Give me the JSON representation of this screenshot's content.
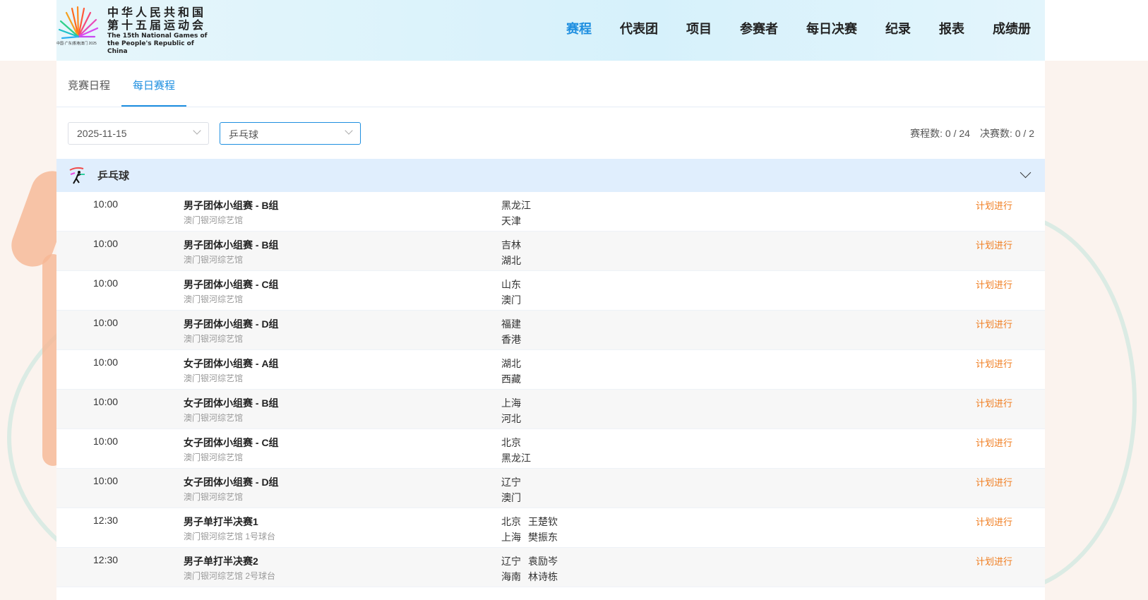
{
  "header": {
    "logo_cn_line1": "中华人民共和国",
    "logo_cn_line2": "第十五届运动会",
    "logo_en_line1": "The 15th National Games of",
    "logo_en_line2": "the People's Republic of China",
    "logo_small": "中国·广东|香港|澳门 2025",
    "nav": [
      "赛程",
      "代表团",
      "项目",
      "参赛者",
      "每日决赛",
      "纪录",
      "报表",
      "成绩册"
    ],
    "active_nav": "赛程"
  },
  "tabs": [
    "竞赛日程",
    "每日赛程"
  ],
  "filters": {
    "date": "2025-11-15",
    "sport": "乒乓球"
  },
  "counts": {
    "schedule": "赛程数: 0 / 24",
    "finals": "决赛数: 0 / 2"
  },
  "group": {
    "title": "乒乓球"
  },
  "rows": [
    {
      "time": "10:00",
      "event": "男子团体小组赛 - B组",
      "venue": "澳门银河综艺馆",
      "team1": "黑龙江",
      "team2": "天津",
      "status": "计划进行"
    },
    {
      "time": "10:00",
      "event": "男子团体小组赛 - B组",
      "venue": "澳门银河综艺馆",
      "team1": "吉林",
      "team2": "湖北",
      "status": "计划进行"
    },
    {
      "time": "10:00",
      "event": "男子团体小组赛 - C组",
      "venue": "澳门银河综艺馆",
      "team1": "山东",
      "team2": "澳门",
      "status": "计划进行"
    },
    {
      "time": "10:00",
      "event": "男子团体小组赛 - D组",
      "venue": "澳门银河综艺馆",
      "team1": "福建",
      "team2": "香港",
      "status": "计划进行"
    },
    {
      "time": "10:00",
      "event": "女子团体小组赛 - A组",
      "venue": "澳门银河综艺馆",
      "team1": "湖北",
      "team2": "西藏",
      "status": "计划进行"
    },
    {
      "time": "10:00",
      "event": "女子团体小组赛 - B组",
      "venue": "澳门银河综艺馆",
      "team1": "上海",
      "team2": "河北",
      "status": "计划进行"
    },
    {
      "time": "10:00",
      "event": "女子团体小组赛 - C组",
      "venue": "澳门银河综艺馆",
      "team1": "北京",
      "team2": "黑龙江",
      "status": "计划进行"
    },
    {
      "time": "10:00",
      "event": "女子团体小组赛 - D组",
      "venue": "澳门银河综艺馆",
      "team1": "辽宁",
      "team2": "澳门",
      "status": "计划进行"
    },
    {
      "time": "12:30",
      "event": "男子单打半决赛1",
      "venue": "澳门银河综艺馆 1号球台",
      "team1": "北京",
      "player1": "王楚钦",
      "team2": "上海",
      "player2": "樊振东",
      "status": "计划进行"
    },
    {
      "time": "12:30",
      "event": "男子单打半决赛2",
      "venue": "澳门银河综艺馆 2号球台",
      "team1": "辽宁",
      "player1": "袁励岑",
      "team2": "海南",
      "player2": "林诗栋",
      "status": "计划进行"
    }
  ]
}
